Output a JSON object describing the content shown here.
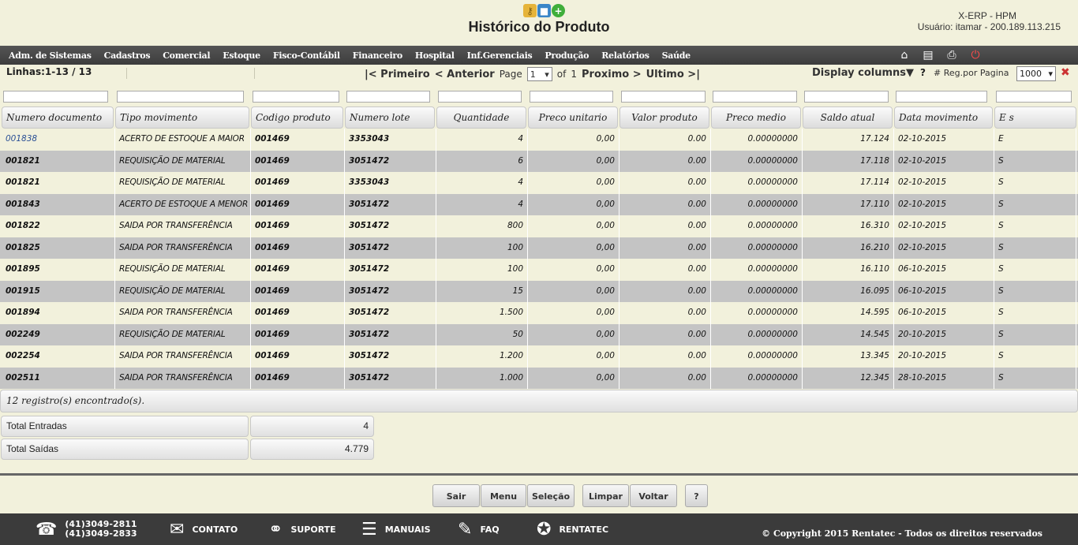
{
  "header": {
    "title": "Histórico do Produto",
    "system_name": "X-ERP - HPM",
    "user_info": "Usuário: itamar - 200.189.113.215",
    "icons": [
      "keys-icon",
      "folder-icon",
      "add-icon"
    ]
  },
  "menu": {
    "items": [
      "Adm. de Sistemas",
      "Cadastros",
      "Comercial",
      "Estoque",
      "Fisco-Contábil",
      "Financeiro",
      "Hospital",
      "Inf.Gerenciais",
      "Produção",
      "Relatórios",
      "Saúde"
    ],
    "tools": [
      "home-icon",
      "document-icon",
      "print-icon",
      "power-icon"
    ]
  },
  "pager": {
    "lines": "Linhas:1-13 / 13",
    "first": "|< Primeiro",
    "previous": "< Anterior",
    "page_label": "Page",
    "page_value": "1",
    "of_label": "of",
    "total_pages": "1",
    "next": "Proximo >",
    "last": "Ultimo >|",
    "display_columns": "Display columns▼",
    "help": "?",
    "reg_label": "# Reg.por Pagina",
    "reg_value": "1000"
  },
  "table": {
    "columns": [
      "Numero documento",
      "Tipo movimento",
      "Codigo produto",
      "Numero lote",
      "Quantidade",
      "Preco unitario",
      "Valor produto",
      "Preco medio",
      "Saldo atual",
      "Data movimento",
      "E s"
    ],
    "rows": [
      [
        "001838",
        "ACERTO DE ESTOQUE A MAIOR",
        "001469",
        "3353043",
        "4",
        "0,00",
        "0.00",
        "0.00000000",
        "17.124",
        "02-10-2015",
        "E"
      ],
      [
        "001821",
        "REQUISIÇÃO DE MATERIAL",
        "001469",
        "3051472",
        "6",
        "0,00",
        "0.00",
        "0.00000000",
        "17.118",
        "02-10-2015",
        "S"
      ],
      [
        "001821",
        "REQUISIÇÃO DE MATERIAL",
        "001469",
        "3353043",
        "4",
        "0,00",
        "0.00",
        "0.00000000",
        "17.114",
        "02-10-2015",
        "S"
      ],
      [
        "001843",
        "ACERTO DE ESTOQUE A MENOR",
        "001469",
        "3051472",
        "4",
        "0,00",
        "0.00",
        "0.00000000",
        "17.110",
        "02-10-2015",
        "S"
      ],
      [
        "001822",
        "SAIDA POR TRANSFERÊNCIA",
        "001469",
        "3051472",
        "800",
        "0,00",
        "0.00",
        "0.00000000",
        "16.310",
        "02-10-2015",
        "S"
      ],
      [
        "001825",
        "SAIDA POR TRANSFERÊNCIA",
        "001469",
        "3051472",
        "100",
        "0,00",
        "0.00",
        "0.00000000",
        "16.210",
        "02-10-2015",
        "S"
      ],
      [
        "001895",
        "REQUISIÇÃO DE MATERIAL",
        "001469",
        "3051472",
        "100",
        "0,00",
        "0.00",
        "0.00000000",
        "16.110",
        "06-10-2015",
        "S"
      ],
      [
        "001915",
        "REQUISIÇÃO DE MATERIAL",
        "001469",
        "3051472",
        "15",
        "0,00",
        "0.00",
        "0.00000000",
        "16.095",
        "06-10-2015",
        "S"
      ],
      [
        "001894",
        "SAIDA POR TRANSFERÊNCIA",
        "001469",
        "3051472",
        "1.500",
        "0,00",
        "0.00",
        "0.00000000",
        "14.595",
        "06-10-2015",
        "S"
      ],
      [
        "002249",
        "REQUISIÇÃO DE MATERIAL",
        "001469",
        "3051472",
        "50",
        "0,00",
        "0.00",
        "0.00000000",
        "14.545",
        "20-10-2015",
        "S"
      ],
      [
        "002254",
        "SAIDA POR TRANSFERÊNCIA",
        "001469",
        "3051472",
        "1.200",
        "0,00",
        "0.00",
        "0.00000000",
        "13.345",
        "20-10-2015",
        "S"
      ],
      [
        "002511",
        "SAIDA POR TRANSFERÊNCIA",
        "001469",
        "3051472",
        "1.000",
        "0,00",
        "0.00",
        "0.00000000",
        "12.345",
        "28-10-2015",
        "S"
      ]
    ],
    "records_found": "12 registro(s) encontrado(s)."
  },
  "totals": {
    "entradas_label": "Total Entradas",
    "entradas_value": "4",
    "saidas_label": "Total Saídas",
    "saidas_value": "4.779"
  },
  "actions": {
    "sair": "Sair",
    "menu": "Menu",
    "selecao": "Seleção",
    "limpar": "Limpar",
    "voltar": "Voltar",
    "help": "?"
  },
  "footer": {
    "phone1": "(41)3049-2811",
    "phone2": "(41)3049-2833",
    "contato": "CONTATO",
    "suporte": "SUPORTE",
    "manuais": "MANUAIS",
    "faq": "FAQ",
    "rentatec": "RENTATEC",
    "copyright": "© Copyright 2015 Rentatec - Todos os direitos reservados"
  }
}
